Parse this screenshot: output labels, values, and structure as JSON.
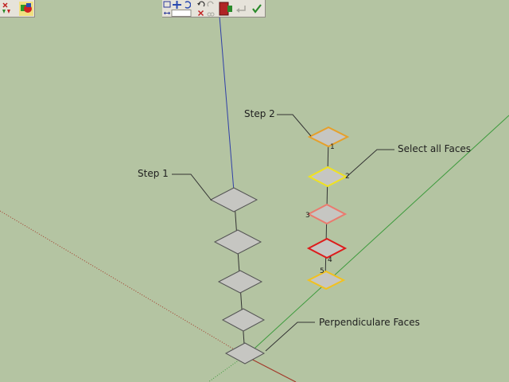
{
  "annotations": {
    "step1": "Step 1",
    "step2": "Step 2",
    "select_all_faces": "Select all Faces",
    "perpendicular_faces": "Perpendiculare Faces"
  },
  "face_numbers": [
    "1",
    "2",
    "3",
    "4",
    "5"
  ],
  "toolbar_icons": [
    "close-x-icon",
    "flip-arrows-icon",
    "paint-blocks-icon",
    "rectangle-select-icon",
    "move-cross-icon",
    "rotate-arc-icon",
    "dimension-icon",
    "undo-icon",
    "redo-icon",
    "delete-icon",
    "cut-icon",
    "export-book-icon",
    "back-arrow-icon",
    "confirm-check-icon"
  ],
  "colors": {
    "background": "#b4c4a2",
    "face_fill": "#c6c6c2",
    "blue_axis": "#2f3fa8",
    "green_axis": "#3c9a3c",
    "red_axis": "#a33a2a",
    "face_orange": "#e5a02a",
    "face_yellow": "#f0e21e",
    "face_salmon": "#ea7a6e",
    "face_red": "#dd1b1b",
    "face_gold": "#f2c11e"
  }
}
